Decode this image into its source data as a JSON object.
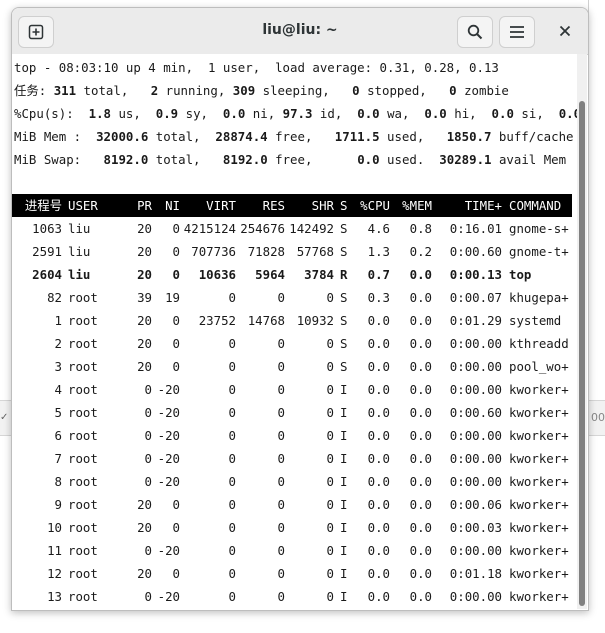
{
  "window": {
    "title": "liu@liu: ~"
  },
  "summary": {
    "line1": "top - 08:03:10 up 4 min,  1 user,  load average: 0.31, 0.28, 0.13",
    "tasks": {
      "label": "任务: ",
      "total": "311",
      "total_lbl": " total,   ",
      "running": "2",
      "running_lbl": " running, ",
      "sleeping": "309",
      "sleeping_lbl": " sleeping,   ",
      "stopped": "0",
      "stopped_lbl": " stopped,   ",
      "zombie": "0",
      "zombie_lbl": " zombie"
    },
    "cpu": {
      "label": "%Cpu(s):  ",
      "us": "1.8",
      "us_lbl": " us,  ",
      "sy": "0.9",
      "sy_lbl": " sy,  ",
      "ni": "0.0",
      "ni_lbl": " ni, ",
      "id": "97.3",
      "id_lbl": " id,  ",
      "wa": "0.0",
      "wa_lbl": " wa,  ",
      "hi": "0.0",
      "hi_lbl": " hi,  ",
      "si": "0.0",
      "si_lbl": " si,  ",
      "st": "0.0",
      "st_lbl": " st"
    },
    "mem": {
      "label": "MiB Mem :  ",
      "total": "32000.6",
      "total_lbl": " total,  ",
      "free": "28874.4",
      "free_lbl": " free,   ",
      "used": "1711.5",
      "used_lbl": " used,   ",
      "buff": "1850.7",
      "buff_lbl": " buff/cache"
    },
    "swap": {
      "label": "MiB Swap:   ",
      "total": "8192.0",
      "total_lbl": " total,   ",
      "free": "8192.0",
      "free_lbl": " free,      ",
      "used": "0.0",
      "used_lbl": " used.  ",
      "avail": "30289.1",
      "avail_lbl": " avail Mem"
    }
  },
  "table": {
    "headers": [
      "进程号",
      "USER",
      "PR",
      "NI",
      "VIRT",
      "RES",
      "SHR",
      "S",
      "%CPU",
      "%MEM",
      "TIME+",
      "COMMAND"
    ],
    "rows": [
      [
        "1063",
        "liu",
        "20",
        "0",
        "4215124",
        "254676",
        "142492",
        "S",
        "4.6",
        "0.8",
        "0:16.01",
        "gnome-s+"
      ],
      [
        "2591",
        "liu",
        "20",
        "0",
        "707736",
        "71828",
        "57768",
        "S",
        "1.3",
        "0.2",
        "0:00.60",
        "gnome-t+"
      ],
      [
        "2604",
        "liu",
        "20",
        "0",
        "10636",
        "5964",
        "3784",
        "R",
        "0.7",
        "0.0",
        "0:00.13",
        "top"
      ],
      [
        "82",
        "root",
        "39",
        "19",
        "0",
        "0",
        "0",
        "S",
        "0.3",
        "0.0",
        "0:00.07",
        "khugepa+"
      ],
      [
        "1",
        "root",
        "20",
        "0",
        "23752",
        "14768",
        "10932",
        "S",
        "0.0",
        "0.0",
        "0:01.29",
        "systemd"
      ],
      [
        "2",
        "root",
        "20",
        "0",
        "0",
        "0",
        "0",
        "S",
        "0.0",
        "0.0",
        "0:00.00",
        "kthreadd"
      ],
      [
        "3",
        "root",
        "20",
        "0",
        "0",
        "0",
        "0",
        "S",
        "0.0",
        "0.0",
        "0:00.00",
        "pool_wo+"
      ],
      [
        "4",
        "root",
        "0",
        "-20",
        "0",
        "0",
        "0",
        "I",
        "0.0",
        "0.0",
        "0:00.00",
        "kworker+"
      ],
      [
        "5",
        "root",
        "0",
        "-20",
        "0",
        "0",
        "0",
        "I",
        "0.0",
        "0.0",
        "0:00.60",
        "kworker+"
      ],
      [
        "6",
        "root",
        "0",
        "-20",
        "0",
        "0",
        "0",
        "I",
        "0.0",
        "0.0",
        "0:00.00",
        "kworker+"
      ],
      [
        "7",
        "root",
        "0",
        "-20",
        "0",
        "0",
        "0",
        "I",
        "0.0",
        "0.0",
        "0:00.00",
        "kworker+"
      ],
      [
        "8",
        "root",
        "0",
        "-20",
        "0",
        "0",
        "0",
        "I",
        "0.0",
        "0.0",
        "0:00.00",
        "kworker+"
      ],
      [
        "9",
        "root",
        "20",
        "0",
        "0",
        "0",
        "0",
        "I",
        "0.0",
        "0.0",
        "0:00.06",
        "kworker+"
      ],
      [
        "10",
        "root",
        "20",
        "0",
        "0",
        "0",
        "0",
        "I",
        "0.0",
        "0.0",
        "0:00.03",
        "kworker+"
      ],
      [
        "11",
        "root",
        "0",
        "-20",
        "0",
        "0",
        "0",
        "I",
        "0.0",
        "0.0",
        "0:00.00",
        "kworker+"
      ],
      [
        "12",
        "root",
        "20",
        "0",
        "0",
        "0",
        "0",
        "I",
        "0.0",
        "0.0",
        "0:01.18",
        "kworker+"
      ],
      [
        "13",
        "root",
        "0",
        "-20",
        "0",
        "0",
        "0",
        "I",
        "0.0",
        "0.0",
        "0:00.00",
        "kworker+"
      ]
    ],
    "highlighted_row": 2
  },
  "colors": {
    "header_bg": "#000000",
    "header_fg": "#ffffff",
    "titlebar": "#ebebeb"
  },
  "icons": {
    "new_tab": "new-tab-icon",
    "search": "search-icon",
    "menu": "hamburger-menu-icon",
    "close": "close-icon"
  }
}
